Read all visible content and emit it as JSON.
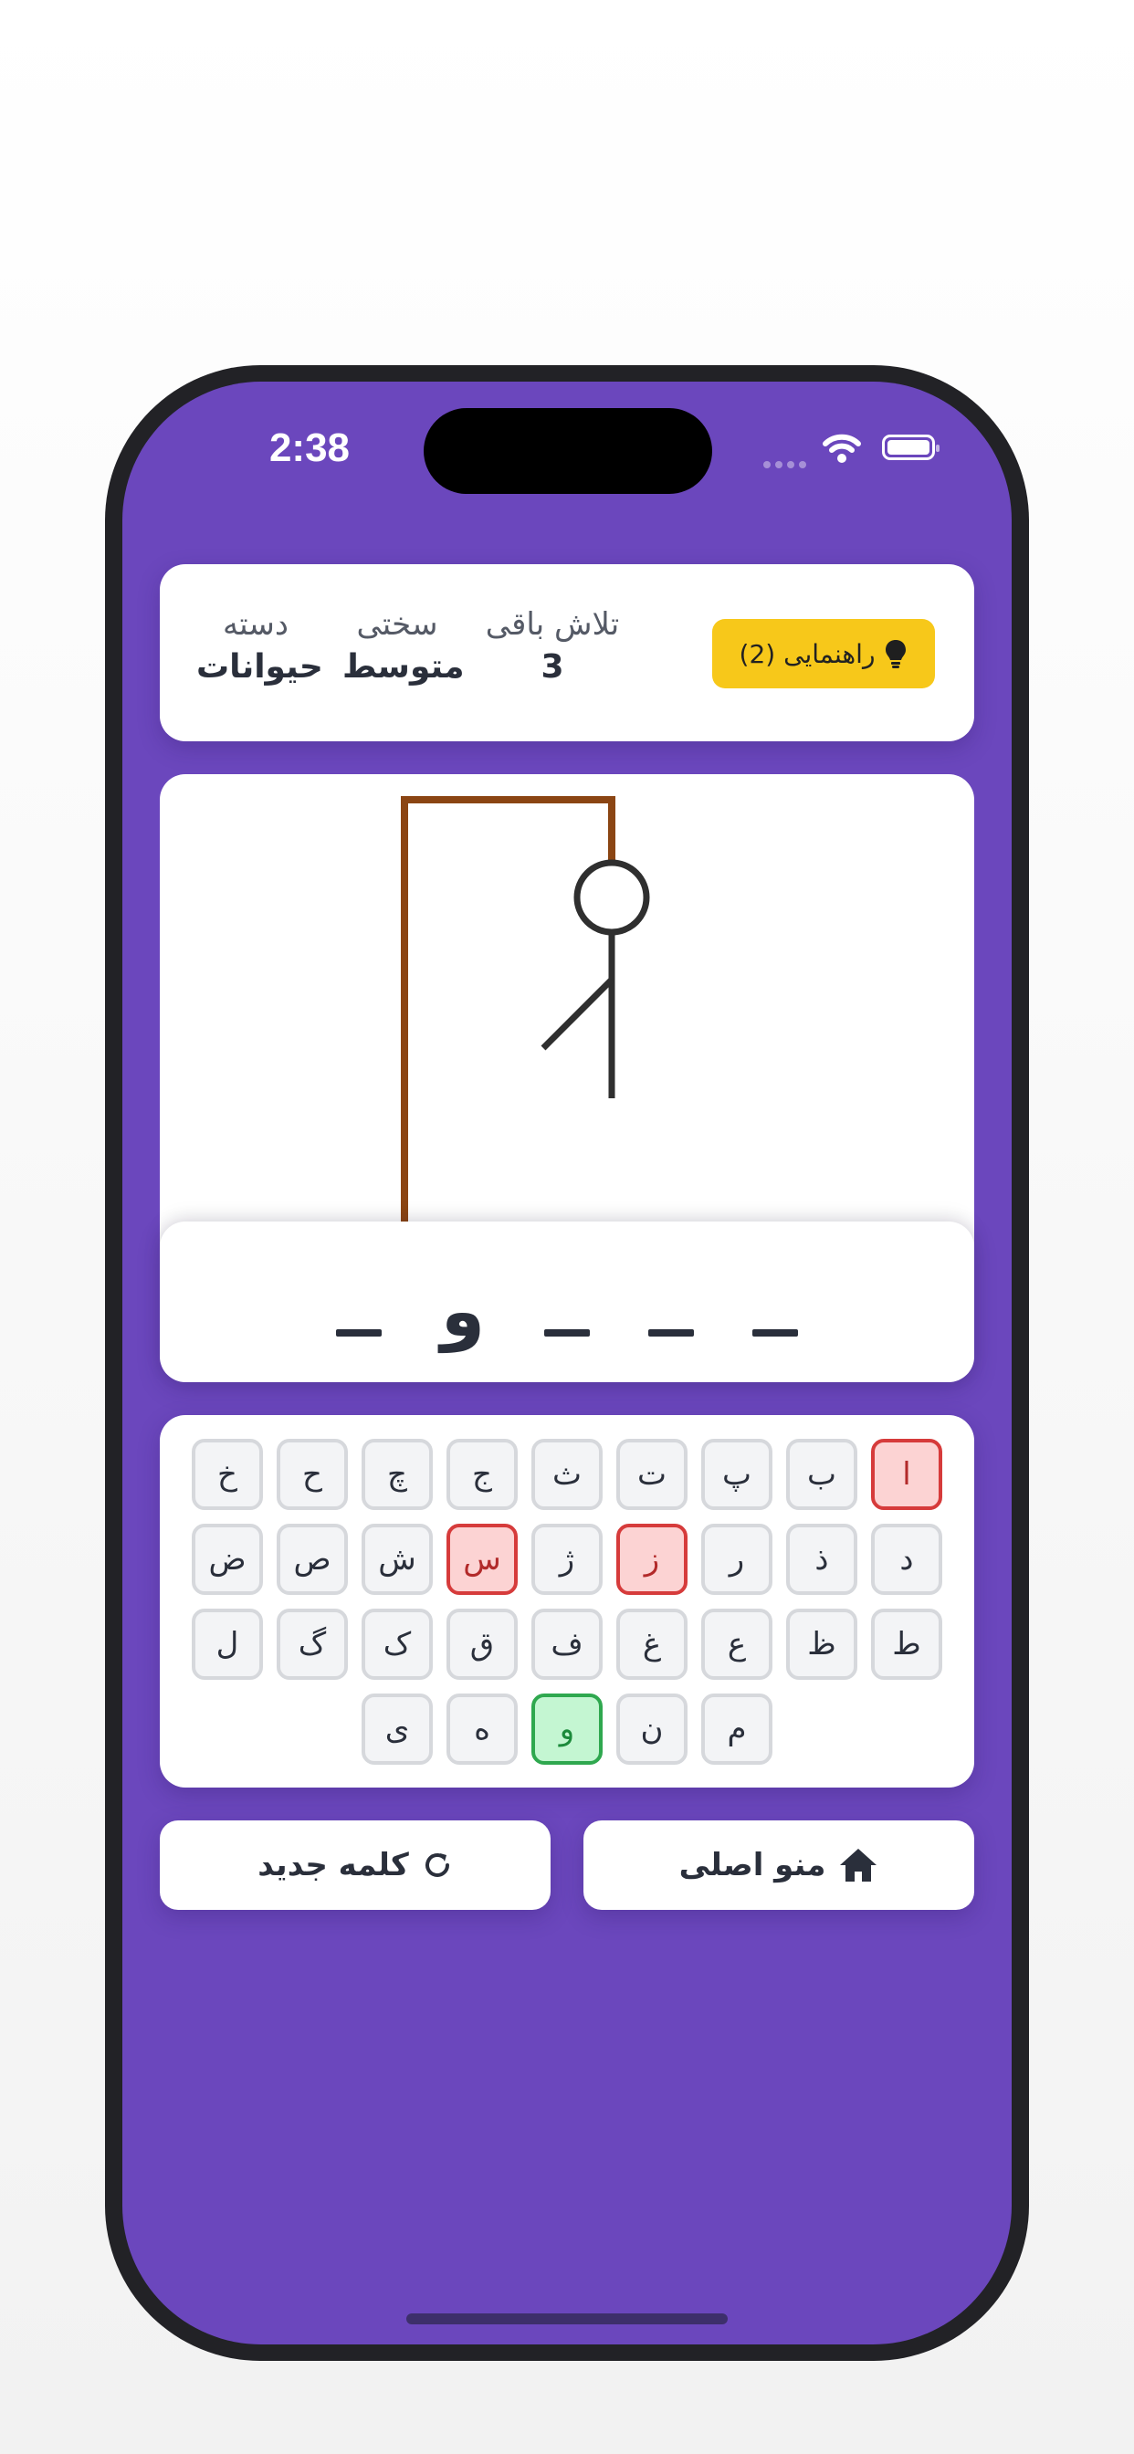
{
  "status_bar": {
    "time": "2:38"
  },
  "info": {
    "category_label": "دسته",
    "category_value": "حیوانات",
    "difficulty_label": "سختی",
    "difficulty_value": "متوسط",
    "attempts_label": "تلاش باقی",
    "attempts_value": "3",
    "hint_button": "راهنمایی (2)"
  },
  "word": {
    "letters": [
      "",
      "",
      "",
      "و",
      ""
    ]
  },
  "keyboard": {
    "rows": [
      [
        {
          "ch": "ا",
          "state": "wrong"
        },
        {
          "ch": "ب",
          "state": ""
        },
        {
          "ch": "پ",
          "state": ""
        },
        {
          "ch": "ت",
          "state": ""
        },
        {
          "ch": "ث",
          "state": ""
        },
        {
          "ch": "ج",
          "state": ""
        },
        {
          "ch": "چ",
          "state": ""
        },
        {
          "ch": "ح",
          "state": ""
        },
        {
          "ch": "خ",
          "state": ""
        }
      ],
      [
        {
          "ch": "د",
          "state": ""
        },
        {
          "ch": "ذ",
          "state": ""
        },
        {
          "ch": "ر",
          "state": ""
        },
        {
          "ch": "ز",
          "state": "wrong"
        },
        {
          "ch": "ژ",
          "state": ""
        },
        {
          "ch": "س",
          "state": "wrong"
        },
        {
          "ch": "ش",
          "state": ""
        },
        {
          "ch": "ص",
          "state": ""
        },
        {
          "ch": "ض",
          "state": ""
        }
      ],
      [
        {
          "ch": "ط",
          "state": ""
        },
        {
          "ch": "ظ",
          "state": ""
        },
        {
          "ch": "ع",
          "state": ""
        },
        {
          "ch": "غ",
          "state": ""
        },
        {
          "ch": "ف",
          "state": ""
        },
        {
          "ch": "ق",
          "state": ""
        },
        {
          "ch": "ک",
          "state": ""
        },
        {
          "ch": "گ",
          "state": ""
        },
        {
          "ch": "ل",
          "state": ""
        }
      ],
      [
        {
          "ch": "م",
          "state": ""
        },
        {
          "ch": "ن",
          "state": ""
        },
        {
          "ch": "و",
          "state": "right"
        },
        {
          "ch": "ه",
          "state": ""
        },
        {
          "ch": "ی",
          "state": ""
        }
      ]
    ]
  },
  "buttons": {
    "main_menu": "منو اصلی",
    "new_word": "کلمه جدید"
  },
  "colors": {
    "background": "#6b47bd",
    "hint": "#f7c81a",
    "gallows": "#8b4513",
    "wrong": "#d63b3b",
    "right": "#2fa84f"
  },
  "icons": {
    "hint": "lightbulb-icon",
    "main_menu": "home-icon",
    "new_word": "refresh-icon"
  }
}
